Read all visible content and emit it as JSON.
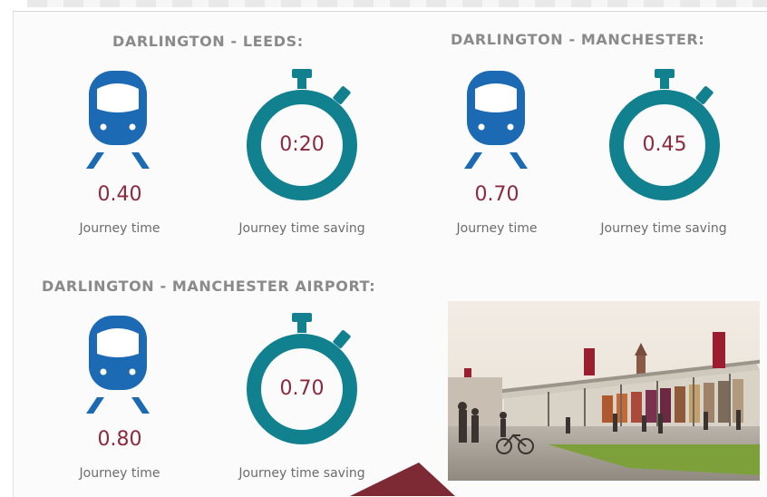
{
  "sections": [
    {
      "title": "DARLINGTON - LEEDS:",
      "journey_time": "0.40",
      "journey_time_saving": "0:20"
    },
    {
      "title": "DARLINGTON - MANCHESTER:",
      "journey_time": "0.70",
      "journey_time_saving": "0.45"
    },
    {
      "title": "DARLINGTON - MANCHESTER AIRPORT:",
      "journey_time": "0.80",
      "journey_time_saving": "0.70"
    }
  ],
  "labels": {
    "journey_time": "Journey time",
    "journey_time_saving": "Journey time saving"
  },
  "icons": {
    "train": "train-front-icon",
    "timer": "stopwatch-icon"
  },
  "colors": {
    "train_blue": "#1b6ab3",
    "stopwatch_teal": "#11808f",
    "value_red": "#8b2a3e",
    "title_grey": "#8a8a8a",
    "caption_grey": "#6c6c6c",
    "accent_maroon": "#7e2a35"
  }
}
